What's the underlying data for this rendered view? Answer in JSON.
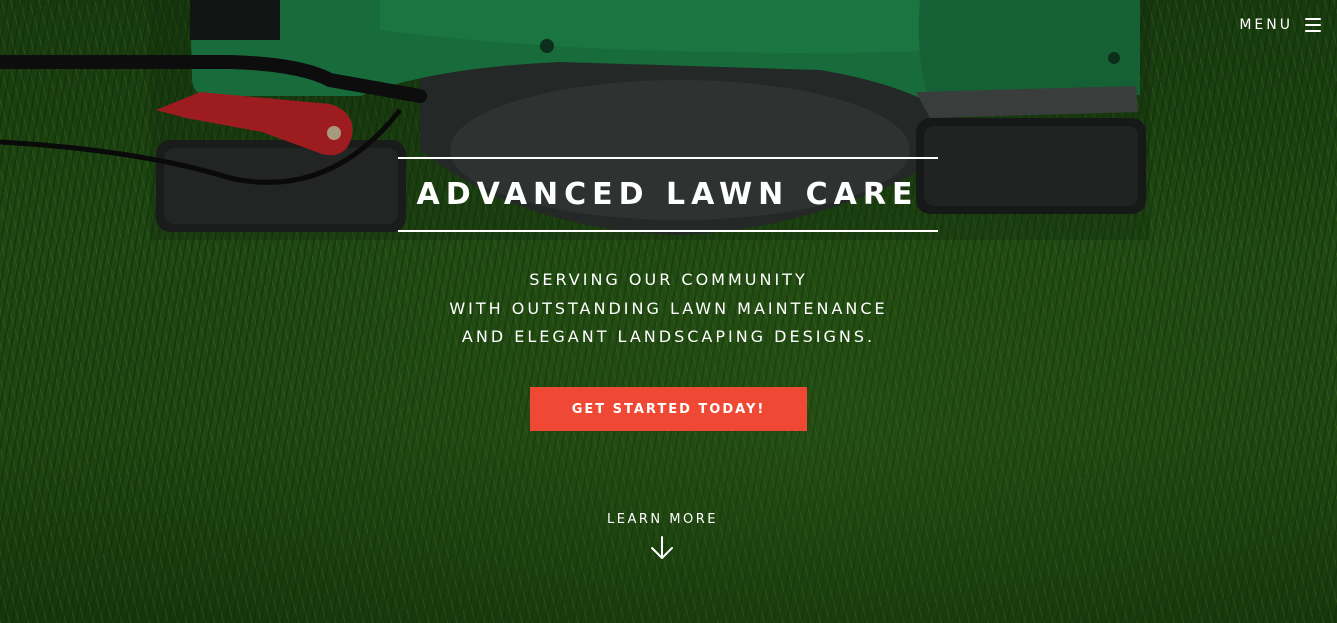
{
  "nav": {
    "menu_label": "MENU",
    "menu_icon": "hamburger-icon"
  },
  "hero": {
    "title": "ADVANCED LAWN CARE",
    "subtitle_lines": [
      "SERVING OUR COMMUNITY",
      "WITH OUTSTANDING LAWN MAINTENANCE",
      "AND ELEGANT LANDSCAPING DESIGNS."
    ],
    "cta_label": "GET STARTED TODAY!",
    "learn_more_label": "LEARN MORE",
    "learn_more_icon": "arrow-down-icon"
  },
  "colors": {
    "accent": "#ef4935",
    "text": "#ffffff",
    "mower_green": "#1f8a4c",
    "grass": "#2b5e1a"
  }
}
